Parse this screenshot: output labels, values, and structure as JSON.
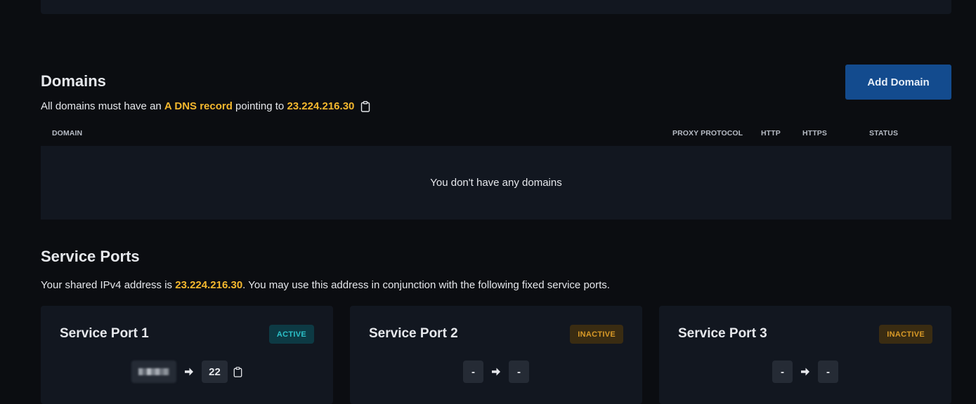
{
  "domains": {
    "title": "Domains",
    "desc_prefix": "All domains must have an ",
    "desc_record": "A DNS record",
    "desc_middle": " pointing to ",
    "ip": "23.224.216.30",
    "add_button": "Add Domain",
    "columns": {
      "domain": "DOMAIN",
      "proxy_protocol": "PROXY PROTOCOL",
      "http": "HTTP",
      "https": "HTTPS",
      "status": "STATUS"
    },
    "empty_message": "You don't have any domains"
  },
  "service_ports": {
    "title": "Service Ports",
    "desc_prefix": "Your shared IPv4 address is ",
    "ip": "23.224.216.30",
    "desc_suffix": ". You may use this address in conjunction with the following fixed service ports.",
    "ports": [
      {
        "name": "Service Port 1",
        "status": "ACTIVE",
        "external": "•••••",
        "internal": "22"
      },
      {
        "name": "Service Port 2",
        "status": "INACTIVE",
        "external": "-",
        "internal": "-"
      },
      {
        "name": "Service Port 3",
        "status": "INACTIVE",
        "external": "-",
        "internal": "-"
      }
    ]
  },
  "icons": {
    "copy": "clipboard-icon",
    "arrow": "arrow-right-icon"
  },
  "colors": {
    "background": "#0b0d11",
    "card": "#121720",
    "highlight": "#f5b82e",
    "primary_button": "#134b8e",
    "active_badge_text": "#2cc1c9",
    "inactive_badge_text": "#d99a27"
  }
}
